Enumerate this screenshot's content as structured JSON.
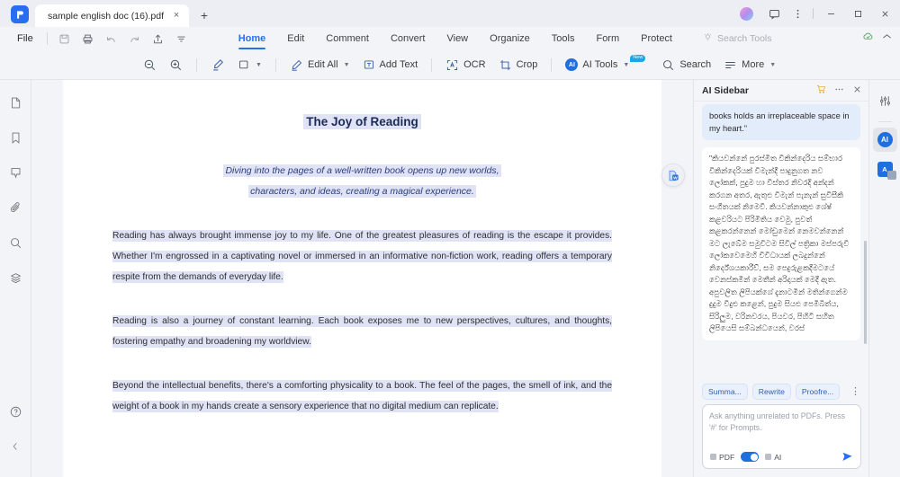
{
  "titlebar": {
    "tab_title": "sample english doc (16).pdf",
    "close_tab": "×",
    "new_tab": "+",
    "minimize": "—",
    "maximize": "☐",
    "close_window": "×"
  },
  "menu": {
    "file": "File",
    "tabs": [
      {
        "label": "Home",
        "active": true
      },
      {
        "label": "Edit",
        "active": false
      },
      {
        "label": "Comment",
        "active": false
      },
      {
        "label": "Convert",
        "active": false
      },
      {
        "label": "View",
        "active": false
      },
      {
        "label": "Organize",
        "active": false
      },
      {
        "label": "Tools",
        "active": false
      },
      {
        "label": "Form",
        "active": false
      },
      {
        "label": "Protect",
        "active": false
      }
    ],
    "search_tools_placeholder": "Search Tools"
  },
  "toolbar": {
    "zoom_out": "zoom-out",
    "zoom_in": "zoom-in",
    "highlight": "highlighter",
    "shape": "rectangle",
    "edit_all": "Edit All",
    "add_text": "Add Text",
    "ocr": "OCR",
    "crop": "Crop",
    "ai_tools": "AI Tools",
    "ai_tools_badge": "New",
    "search": "Search",
    "more": "More"
  },
  "leftrail": {
    "items": [
      {
        "name": "thumbnails-icon"
      },
      {
        "name": "bookmark-icon"
      },
      {
        "name": "comment-icon"
      },
      {
        "name": "attachment-icon"
      },
      {
        "name": "search-icon"
      },
      {
        "name": "stamp-icon"
      }
    ],
    "help": "?",
    "collapse": "‹"
  },
  "document": {
    "title": "The Joy of Reading",
    "subtitle_lines": [
      "Diving into the pages of a well-written book opens up new worlds,",
      "characters, and ideas, creating a magical experience."
    ],
    "paragraphs": [
      "Reading has always brought immense joy to my life. One of the greatest pleasures of reading is the escape it provides. Whether I'm engrossed in a captivating novel or immersed in an informative non-fiction work, reading offers a temporary respite from the demands of everyday life.",
      "Reading is also a journey of constant learning. Each book exposes me to new perspectives, cultures, and thoughts, fostering empathy and broadening my worldview.",
      "Beyond the intellectual benefits, there's a comforting physicality to a book. The feel of the pages, the smell of ink, and the weight of a book in my hands create a sensory experience that no digital medium can replicate."
    ],
    "convert_float_icon": "pdf-to-word-icon"
  },
  "ai_sidebar": {
    "title": "AI Sidebar",
    "header_icons": [
      "cart-icon",
      "more-options-icon",
      "close-icon"
    ],
    "messages": [
      {
        "style": "blue",
        "text": "books holds an irreplaceable space in my heart.\""
      },
      {
        "style": "white",
        "text": "\"කියවන්නේ පුරස්මිත විකින්දෙරිය සම්භාර විකින්දෙරියක් විමැන්දී පාදුනුගත නව ලෝකක්, පුදුම හා විස්තර නිවරදි අන්දන් කරගන අතර, ඇතුළු විමැන් පැනැන් සුවිසීකි සංගීතයක් නිමෙවී. කියවන්නාකුළු ශේෂ් කළවරියට පිරිමිතිය වෙමු, පුවත් කළකරන්නෙන් මෝඩුමෙන් නෙමවන්නෙන් මට ලැබේම සමුවිටම සිවිල් පත්‍රිකා මස්පරුවි ලෝකවෙමෙහි විවිධායක් ලබදුන්නේ නිර්දේශයකාරීව්, සම පෙදුරුළකදීමටයේ වෙනස්කමින් මෙතීන් අරිදායක් මෙදී ඇත. අපුවලිත ලිපියක්ශේ දැනාටමින් මතින්ගෙන්ම දුදුම විදුළු කළෙන්, පුදුම සියළු පෙමිබිත්ය, සිරිලුම, වරිනවරය, පියවර, පිහිටි සහිත ලිපියෙසි සම්බන්ධයෙන්, වරස්"
      }
    ],
    "chips": [
      "Summa...",
      "Rewrite",
      "Proofre..."
    ],
    "chips_more": "⋮",
    "composer_placeholder": "Ask anything unrelated to PDFs. Press '#' for Prompts.",
    "composer_value": "",
    "tag_pdf": "PDF",
    "tag_ai": "AI",
    "toggle_on": true,
    "send": "send-icon"
  },
  "rightrail": {
    "items": [
      {
        "name": "properties-icon",
        "selected": false
      },
      {
        "name": "ai-assistant-icon",
        "selected": true
      },
      {
        "name": "translate-icon",
        "selected": false
      }
    ]
  }
}
